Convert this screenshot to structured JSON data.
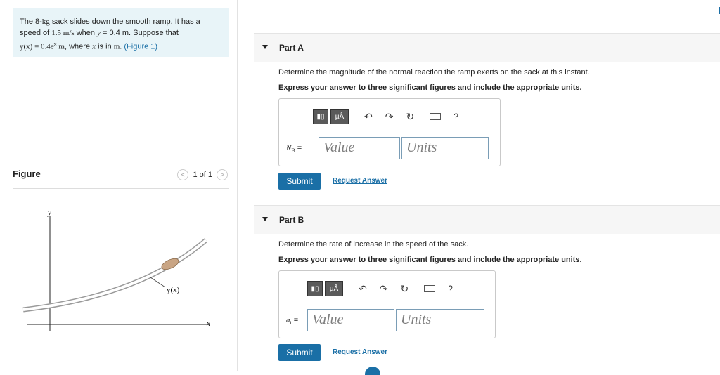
{
  "problem": {
    "line1_prefix": "The 8-",
    "mass_unit": "kg",
    "line1_suffix": " sack slides down the smooth ramp. It has a",
    "line2_prefix": "speed of ",
    "speed": "1.5 m/s",
    "line2_mid": " when ",
    "ycond": "y",
    "ycond_val": " = 0.4 m",
    "line2_suffix": ". Suppose that",
    "eq": "y(x) = 0.4e",
    "eq_sup": "x",
    "eq_unit": " m",
    "line3_mid": ", where ",
    "xvar": "x",
    "line3_mid2": " is in ",
    "munit": "m",
    "line3_end": ". ",
    "fig_link": "(Figure 1)"
  },
  "figure": {
    "title": "Figure",
    "pager_text": "1 of 1",
    "prev_icon": "chevron-left-icon",
    "next_icon": "chevron-right-icon",
    "axis_y": "y",
    "axis_x": "x",
    "curve_label": "y(x)"
  },
  "partA": {
    "label": "Part A",
    "question": "Determine the magnitude of the normal reaction the ramp exerts on the sack at this instant.",
    "instruction": "Express your answer to three significant figures and include the appropriate units.",
    "field_label": "N",
    "field_sub": "B",
    "field_eq": " =",
    "value_placeholder": "Value",
    "units_placeholder": "Units",
    "submit": "Submit",
    "request": "Request Answer"
  },
  "partB": {
    "label": "Part B",
    "question": "Determine the rate of increase in the speed of the sack.",
    "instruction": "Express your answer to three significant figures and include the appropriate units.",
    "field_label": "a",
    "field_sub": "t",
    "field_eq": " =",
    "value_placeholder": "Value",
    "units_placeholder": "Units",
    "submit": "Submit",
    "request": "Request Answer"
  },
  "toolbar": {
    "templates": "templates-icon",
    "mu": "μÅ",
    "undo": "↶",
    "redo": "↷",
    "reset": "↻",
    "keyboard": "keyboard-icon",
    "help": "?"
  }
}
